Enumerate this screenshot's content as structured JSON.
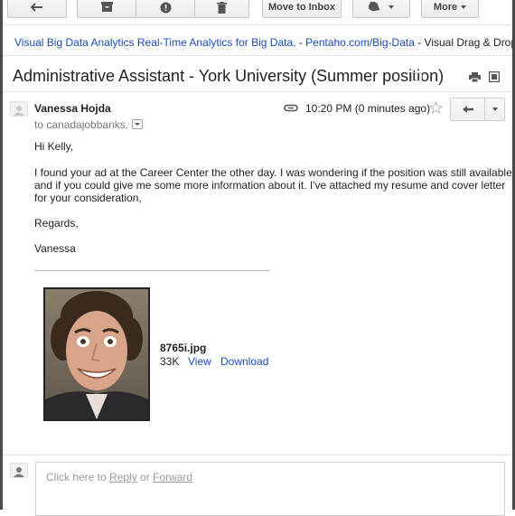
{
  "toolbar": {
    "back_icon": "back-arrow-icon",
    "archive_icon": "archive-icon",
    "spam_icon": "report-spam-icon",
    "delete_icon": "trash-icon",
    "move_to_inbox_label": "Move to Inbox",
    "labels_icon": "label-tag-icon",
    "more_label": "More"
  },
  "ad": {
    "link_text": "Visual Big Data Analytics Real-Time Analytics for Big Data.",
    "separator": " - ",
    "url": "Pentaho.com/Big-Data",
    "description": " - Visual Drag & Drop U"
  },
  "message": {
    "subject": "Administrative Assistant - York University (Summer position)",
    "sender": "Vanessa Hojda",
    "to_line": "to canadajobbanks.",
    "time": "10:20 PM (0 minutes ago)",
    "greeting": "Hi Kelly,",
    "body_lines": [
      "I found your ad at the Career Center the other day. I was wondering if the position was still available",
      "and if you could give me some more information about it. I've attached my resume and cover letter",
      "for your consideration,"
    ],
    "closing": "Regards,",
    "signature": "Vanessa"
  },
  "attachment": {
    "filename": "8765i.jpg",
    "size": "33K",
    "view_label": "View",
    "download_label": "Download"
  },
  "reply": {
    "prefix": "Click here to ",
    "reply_link": "Reply",
    "middle": " or ",
    "forward_link": "Forward"
  },
  "colors": {
    "link": "#1a4bb5",
    "frame": "#4a4a4a"
  }
}
